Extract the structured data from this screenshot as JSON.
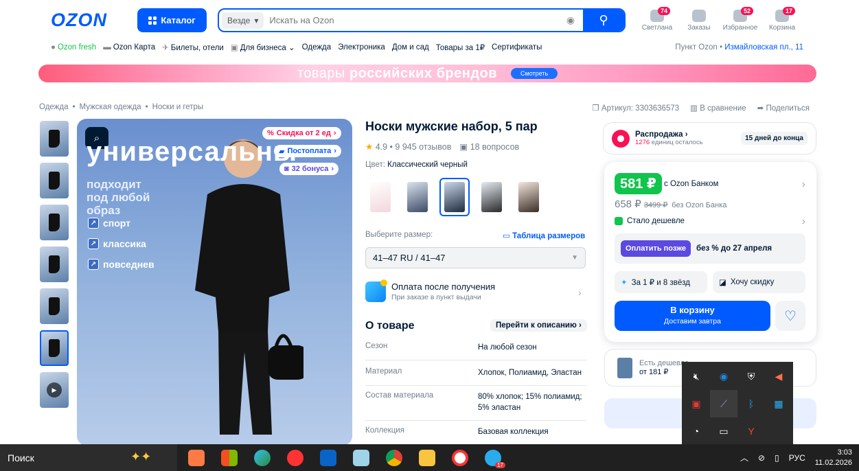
{
  "header": {
    "logo": "OZON",
    "catalog": "Каталог",
    "scope": "Везде",
    "search_placeholder": "Искать на Ozon",
    "icons": [
      {
        "label": "Светлана",
        "badge": "74"
      },
      {
        "label": "Заказы",
        "badge": ""
      },
      {
        "label": "Избранное",
        "badge": "52"
      },
      {
        "label": "Корзина",
        "badge": "17"
      }
    ]
  },
  "nav": {
    "items": [
      "Ozon fresh",
      "Ozon Карта",
      "Билеты, отели",
      "Для бизнеса",
      "Одежда",
      "Электроника",
      "Дом и сад",
      "Товары за 1₽",
      "Сертификаты"
    ],
    "pickup_label": "Пункт Ozon •",
    "pickup_addr": "Измайловская пл., 11"
  },
  "banner": {
    "text1": "товары ",
    "text2": "российских брендов",
    "button": "Смотреть"
  },
  "breadcrumb": [
    "Одежда",
    "Мужская одежда",
    "Носки и гетры"
  ],
  "meta": {
    "article": "Артикул: 3303636573",
    "compare": "В сравнение",
    "share": "Поделиться"
  },
  "image": {
    "big_word": "универсальны",
    "sub1": "подходит",
    "sub2": "под любой",
    "sub3": "образ",
    "features": [
      "спорт",
      "классика",
      "повседнев"
    ],
    "pill1": "Скидка от 2 ед",
    "pill2": "Постоплата",
    "pill3": "32 бонуса"
  },
  "product": {
    "title": "Носки мужские набор, 5 пар",
    "rating": "4.9 • 9 945 отзывов",
    "questions": "18 вопросов",
    "color_label": "Цвет:",
    "color_value": "Классический черный",
    "size_label": "Выберите размер:",
    "size_table": "Таблица размеров",
    "size_value": "41–47 RU / 41–47",
    "pay_title": "Оплата после получения",
    "pay_sub": "При заказе в пункт выдачи",
    "about": "О товаре",
    "to_desc": "Перейти к описанию",
    "specs": [
      {
        "k": "Сезон",
        "v": "На любой сезон"
      },
      {
        "k": "Материал",
        "v": "Хлопок, Полиамид, Эластан"
      },
      {
        "k": "Состав материала",
        "v": "80% хлопок; 15% полиамид; 5% эластан"
      },
      {
        "k": "Коллекция",
        "v": "Базовая коллекция"
      }
    ]
  },
  "sale": {
    "title": "Распродажа",
    "count": "1276",
    "count_suffix": " единиц осталось",
    "days": "15 дней до конца"
  },
  "buy": {
    "price": "581 ₽",
    "bank": "с Ozon Банком",
    "old": "658 ₽",
    "crossed": "3499 ₽",
    "nobank": "без Ozon Банка",
    "cheaper": "Стало дешевле",
    "later_btn": "Оплатить позже",
    "later_text": "без % до 27 апреля",
    "stars": "За 1 ₽ и 8 звёзд",
    "discount": "Хочу скидку",
    "cart1": "В корзину",
    "cart2": "Доставим завтра"
  },
  "cheap": {
    "t1": "Есть дешевле",
    "t2": "от 181 ₽"
  },
  "taskbar": {
    "search": "Поиск",
    "lang": "РУС",
    "time": "3:03",
    "date": "11.02.2026",
    "tg_badge": "17"
  }
}
